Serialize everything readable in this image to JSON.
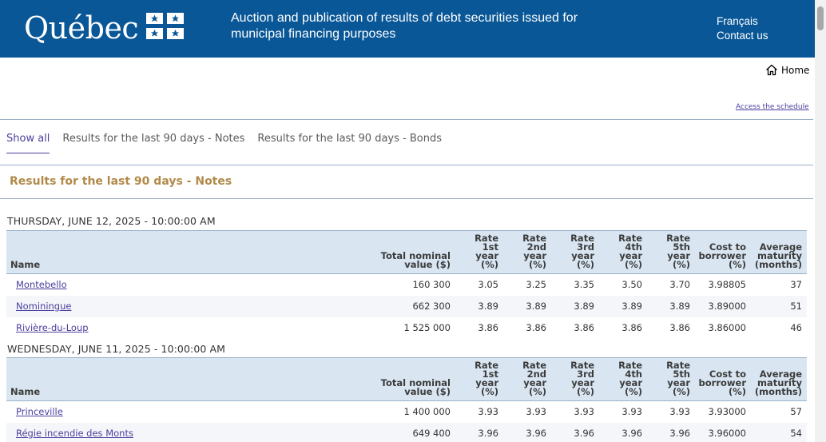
{
  "header": {
    "logo": "Québec",
    "title": "Auction and publication of results of debt securities issued for municipal financing purposes",
    "links": [
      "Français",
      "Contact us"
    ],
    "colors": {
      "band": "#095797",
      "accent": "#b18a4a",
      "link": "#4a3f9e"
    }
  },
  "nav": {
    "home": "Home",
    "home_icon": "home-icon",
    "schedule": "Access the schedule"
  },
  "tabs": [
    {
      "label": "Show all",
      "active": true
    },
    {
      "label": "Results for the last 90 days - Notes",
      "active": false
    },
    {
      "label": "Results for the last 90 days - Bonds",
      "active": false
    }
  ],
  "section_title": "Results for the last 90 days - Notes",
  "table_headers": [
    "Name",
    "Total nominal value ($)",
    "Rate 1st year (%)",
    "Rate 2nd year (%)",
    "Rate 3rd year (%)",
    "Rate 4th year (%)",
    "Rate 5th year (%)",
    "Cost to borrower (%)",
    "Average maturity (months)"
  ],
  "auctions": [
    {
      "date": "THURSDAY, JUNE 12, 2025 - 10:00:00 AM",
      "rows": [
        [
          "Montebello",
          "160 300",
          "3.05",
          "3.25",
          "3.35",
          "3.50",
          "3.70",
          "3.98805",
          "37"
        ],
        [
          "Nominingue",
          "662 300",
          "3.89",
          "3.89",
          "3.89",
          "3.89",
          "3.89",
          "3.89000",
          "51"
        ],
        [
          "Rivière-du-Loup",
          "1 525 000",
          "3.86",
          "3.86",
          "3.86",
          "3.86",
          "3.86",
          "3.86000",
          "46"
        ]
      ]
    },
    {
      "date": "WEDNESDAY, JUNE 11, 2025 - 10:00:00 AM",
      "rows": [
        [
          "Princeville",
          "1 400 000",
          "3.93",
          "3.93",
          "3.93",
          "3.93",
          "3.93",
          "3.93000",
          "57"
        ],
        [
          "Régie incendie des Monts",
          "649 400",
          "3.96",
          "3.96",
          "3.96",
          "3.96",
          "3.96",
          "3.96000",
          "54"
        ]
      ]
    }
  ]
}
